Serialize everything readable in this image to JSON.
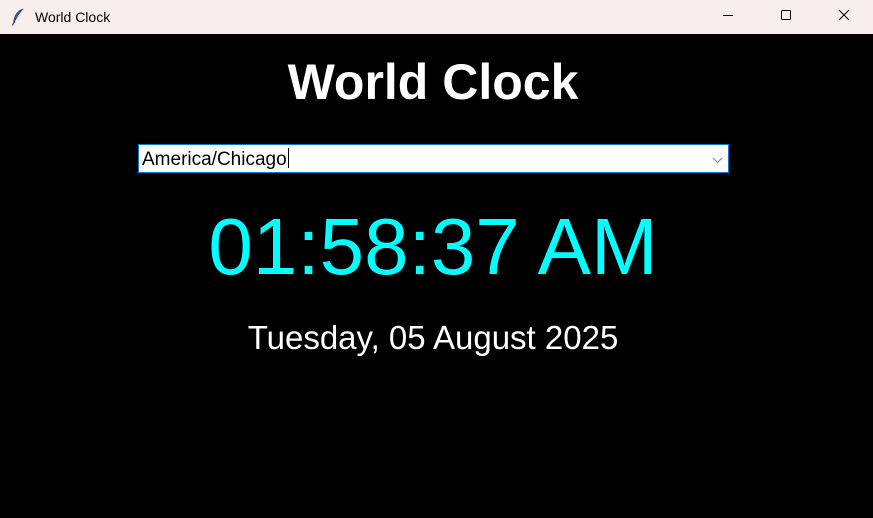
{
  "window": {
    "title": "World Clock",
    "app_icon": "feather-icon",
    "controls": [
      "minimize-icon",
      "maximize-icon",
      "close-icon"
    ]
  },
  "main": {
    "heading": "World Clock",
    "timezone_select": {
      "value": "America/Chicago",
      "dropdown_icon": "chevron-down-icon"
    },
    "time": "01:58:37 AM",
    "date": "Tuesday, 05 August 2025"
  },
  "colors": {
    "background": "#000000",
    "titlebar": "#f8eeec",
    "heading": "#ffffff",
    "time": "#00ffff",
    "date": "#ffffff",
    "select_border": "#0a78d7"
  }
}
